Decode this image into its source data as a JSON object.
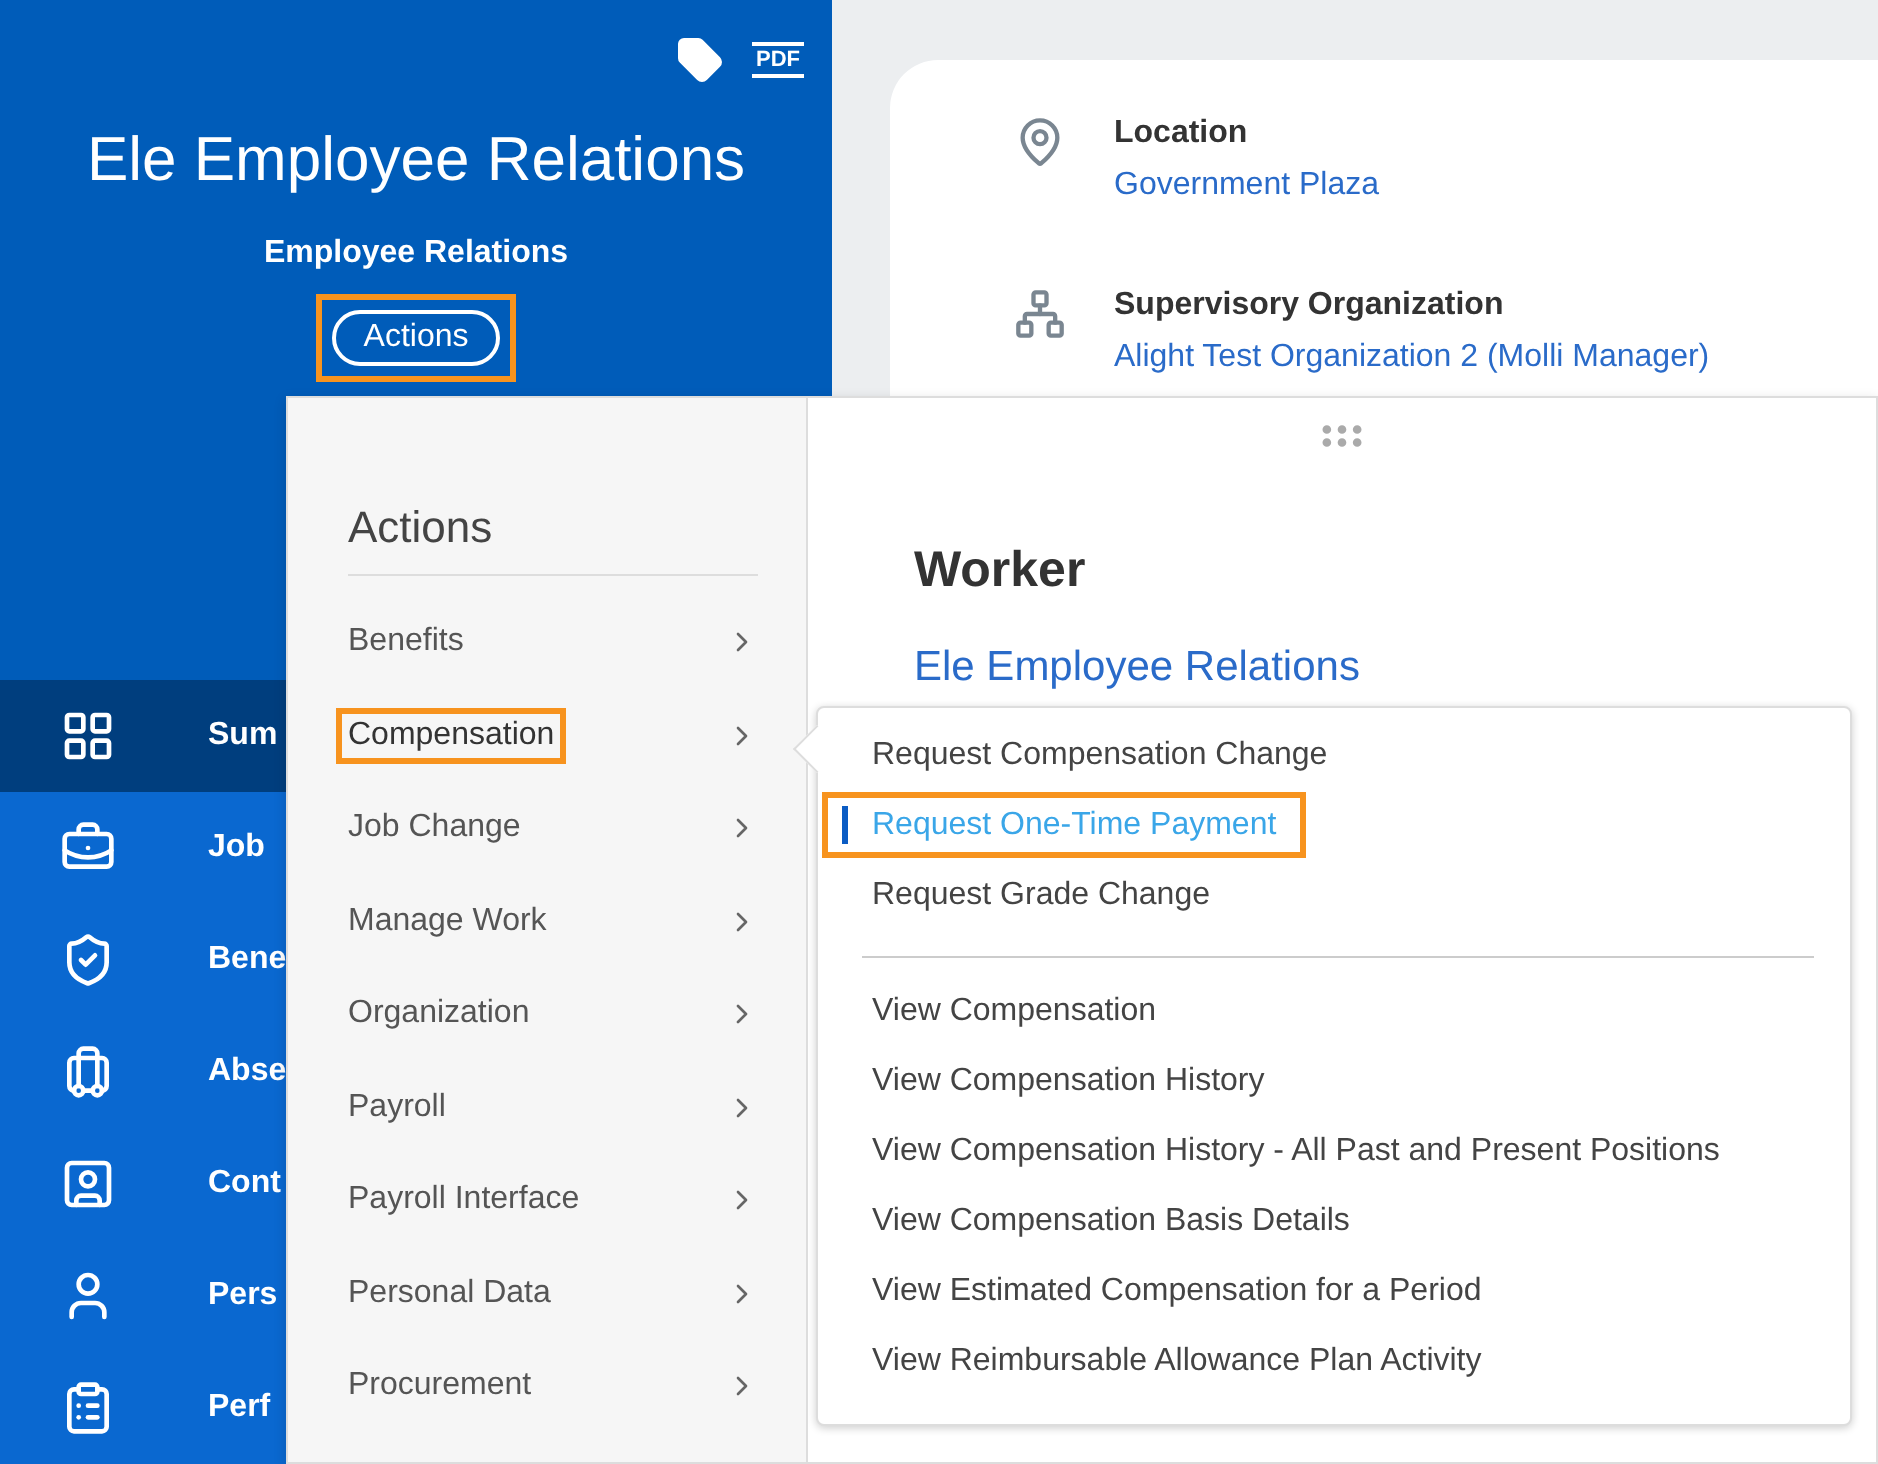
{
  "header": {
    "pdf_label": "PDF",
    "title": "Ele Employee Relations",
    "subtitle": "Employee Relations",
    "actions_button": {
      "label": "Actions",
      "highlighted": true
    }
  },
  "nav": [
    {
      "label": "Sum",
      "selected": true
    },
    {
      "label": "Job",
      "selected": false
    },
    {
      "label": "Bene",
      "selected": false
    },
    {
      "label": "Abse",
      "selected": false
    },
    {
      "label": "Cont",
      "selected": false
    },
    {
      "label": "Pers",
      "selected": false
    },
    {
      "label": "Perf",
      "selected": false
    }
  ],
  "card": {
    "fields": [
      {
        "label": "Location",
        "value": "Government Plaza"
      },
      {
        "label": "Supervisory Organization",
        "value": "Alight Test Organization 2 (Molli Manager)"
      }
    ]
  },
  "actions_menu": {
    "title": "Actions",
    "items": [
      {
        "label": "Benefits",
        "selected": false,
        "highlighted": false
      },
      {
        "label": "Compensation",
        "selected": true,
        "highlighted": true
      },
      {
        "label": "Job Change",
        "selected": false,
        "highlighted": false
      },
      {
        "label": "Manage Work",
        "selected": false,
        "highlighted": false
      },
      {
        "label": "Organization",
        "selected": false,
        "highlighted": false
      },
      {
        "label": "Payroll",
        "selected": false,
        "highlighted": false
      },
      {
        "label": "Payroll Interface",
        "selected": false,
        "highlighted": false
      },
      {
        "label": "Personal Data",
        "selected": false,
        "highlighted": false
      },
      {
        "label": "Procurement",
        "selected": false,
        "highlighted": false
      }
    ]
  },
  "worker": {
    "heading": "Worker",
    "name": "Ele Employee Relations"
  },
  "submenu": {
    "groups": [
      [
        {
          "label": "Request Compensation Change",
          "selected": false,
          "highlighted": false
        },
        {
          "label": "Request One-Time Payment",
          "selected": true,
          "highlighted": true
        },
        {
          "label": "Request Grade Change",
          "selected": false,
          "highlighted": false
        }
      ],
      [
        {
          "label": "View Compensation",
          "selected": false,
          "highlighted": false
        },
        {
          "label": "View Compensation History",
          "selected": false,
          "highlighted": false
        },
        {
          "label": "View Compensation History - All Past and Present Positions",
          "selected": false,
          "highlighted": false
        },
        {
          "label": "View Compensation Basis Details",
          "selected": false,
          "highlighted": false
        },
        {
          "label": "View Estimated Compensation for a Period",
          "selected": false,
          "highlighted": false
        },
        {
          "label": "View Reimbursable Allowance Plan Activity",
          "selected": false,
          "highlighted": false
        }
      ]
    ]
  }
}
